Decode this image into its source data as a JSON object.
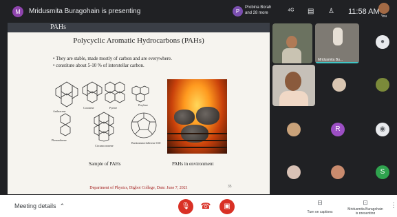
{
  "topbar": {
    "presenter_initial": "M",
    "presenting_text": "Mridusmita Buragohain is presenting",
    "pinned_initial": "P",
    "pinned_text": "Probina Borah and 28 more",
    "clock": "11:58 AM",
    "self_label": "You"
  },
  "slide": {
    "header_title": "PAHs",
    "title": "Polycyclic Aromatic Hydrocarbons (PAHs)",
    "bullets": [
      "• They are stable, made mostly of carbon and are everywhere.",
      "• constitute about 5-10 % of interstellar carbon."
    ],
    "molecules": [
      "Anthracene",
      "Coronene",
      "Pyrene",
      "Perylene",
      "Phenanthrene",
      "Circumcoronene",
      "Buckminsterfullerene C60"
    ],
    "caption_left": "Sample of PAHs",
    "caption_right": "PAHs in environment",
    "footer": "Department of Physics, Digboi College, Date: June 7, 2021",
    "slide_number": "35"
  },
  "participants": {
    "tile_name_2": "Mridusmita Bu...",
    "avatar_r": "R",
    "avatar_s": "S",
    "colors": {
      "r": "#9c4fc4",
      "s": "#2fa34e"
    }
  },
  "bottombar": {
    "meeting_details": "Meeting details",
    "captions_label": "Turn on captions",
    "presenting_label": "Mridusmita Buragohain is presenting"
  },
  "icons": [
    "chevron-up-icon",
    "mic-off-icon",
    "call-end-icon",
    "camera-off-icon",
    "captions-icon",
    "present-icon",
    "more-vert-icon",
    "people-icon",
    "chat-icon",
    "layout-icon"
  ]
}
